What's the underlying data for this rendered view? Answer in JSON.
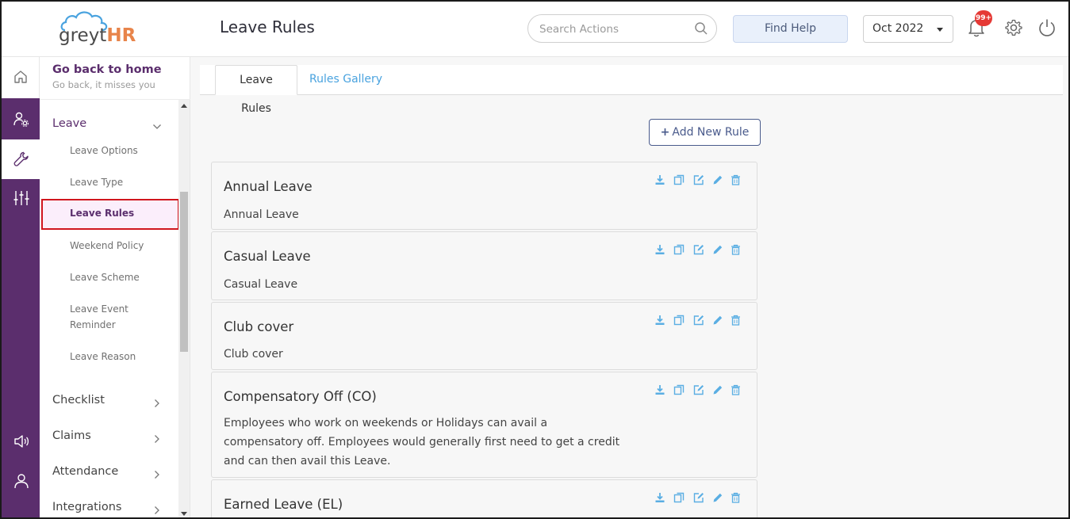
{
  "header": {
    "logo_part1": "greyt",
    "logo_part2": "HR",
    "page_title": "Leave Rules",
    "search_placeholder": "Search Actions",
    "find_help": "Find Help",
    "month": "Oct 2022",
    "notification_badge": "99+"
  },
  "sidebar": {
    "go_home_title": "Go back to home",
    "go_home_subtitle": "Go back, it misses you",
    "section": "Leave",
    "subitems": [
      {
        "label": "Leave Options"
      },
      {
        "label": "Leave Type"
      },
      {
        "label": "Leave Rules"
      },
      {
        "label": "Weekend Policy"
      },
      {
        "label": "Leave Scheme"
      },
      {
        "label": "Leave Event Reminder"
      },
      {
        "label": "Leave Reason"
      }
    ],
    "main_items": [
      {
        "label": "Checklist"
      },
      {
        "label": "Claims"
      },
      {
        "label": "Attendance"
      },
      {
        "label": "Integrations"
      }
    ]
  },
  "tabs": [
    {
      "label": "Leave Rules"
    },
    {
      "label": "Rules Gallery"
    }
  ],
  "add_rule_label": "Add New Rule",
  "rules": [
    {
      "title": "Annual Leave",
      "description": "Annual Leave"
    },
    {
      "title": "Casual Leave",
      "description": "Casual Leave"
    },
    {
      "title": "Club cover",
      "description": "Club cover"
    },
    {
      "title": "Compensatory Off (CO)",
      "description": "Employees who work on weekends or Holidays can avail a compensatory off. Employees would generally first need to get a credit and can then avail this Leave."
    },
    {
      "title": "Earned Leave (EL)",
      "description": ""
    }
  ],
  "colors": {
    "brand_purple": "#5b2e6d",
    "link_blue": "#4aa3df",
    "icon_blue": "#5aaee3",
    "badge_red": "#e53935",
    "logo_orange": "#e8844a"
  }
}
